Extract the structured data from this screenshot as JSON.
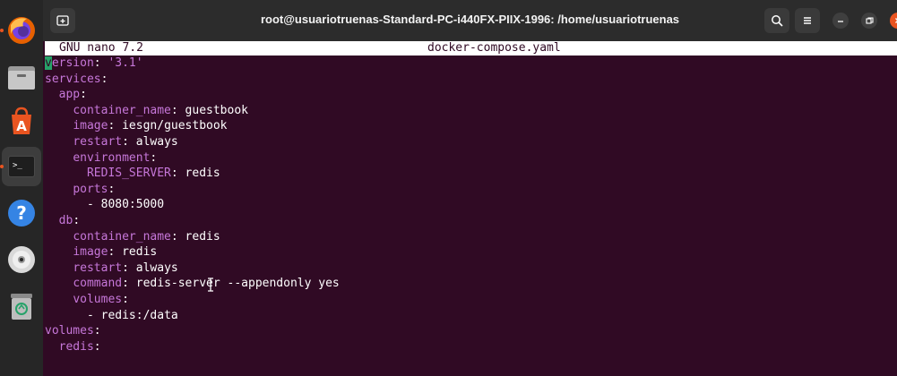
{
  "window": {
    "title": "root@usuariotruenas-Standard-PC-i440FX-PIIX-1996: /home/usuariotruenas"
  },
  "dock": {
    "items": [
      {
        "name": "firefox-icon"
      },
      {
        "name": "files-icon"
      },
      {
        "name": "app-center-icon"
      },
      {
        "name": "terminal-icon"
      },
      {
        "name": "help-icon"
      },
      {
        "name": "disc-icon"
      },
      {
        "name": "trash-icon"
      }
    ]
  },
  "nano": {
    "version": "GNU nano 7.2",
    "filename": "docker-compose.yaml"
  },
  "file_lines": [
    {
      "indent": "",
      "key": "version",
      "sep": ": ",
      "value": "'3.1'",
      "value_is_string": true
    },
    {
      "indent": "",
      "key": "services",
      "sep": ":",
      "value": ""
    },
    {
      "indent": "  ",
      "key": "app",
      "sep": ":",
      "value": ""
    },
    {
      "indent": "    ",
      "key": "container_name",
      "sep": ": ",
      "value": "guestbook"
    },
    {
      "indent": "    ",
      "key": "image",
      "sep": ": ",
      "value": "iesgn/guestbook"
    },
    {
      "indent": "    ",
      "key": "restart",
      "sep": ": ",
      "value": "always"
    },
    {
      "indent": "    ",
      "key": "environment",
      "sep": ":",
      "value": ""
    },
    {
      "indent": "      ",
      "key": "REDIS_SERVER",
      "sep": ": ",
      "value": "redis"
    },
    {
      "indent": "    ",
      "key": "ports",
      "sep": ":",
      "value": ""
    },
    {
      "indent": "      ",
      "key": "",
      "sep": "- ",
      "value": "8080:5000"
    },
    {
      "indent": "  ",
      "key": "db",
      "sep": ":",
      "value": ""
    },
    {
      "indent": "    ",
      "key": "container_name",
      "sep": ": ",
      "value": "redis"
    },
    {
      "indent": "    ",
      "key": "image",
      "sep": ": ",
      "value": "redis"
    },
    {
      "indent": "    ",
      "key": "restart",
      "sep": ": ",
      "value": "always"
    },
    {
      "indent": "    ",
      "key": "command",
      "sep": ": ",
      "value": "redis-server --appendonly yes"
    },
    {
      "indent": "    ",
      "key": "volumes",
      "sep": ":",
      "value": ""
    },
    {
      "indent": "      ",
      "key": "",
      "sep": "- ",
      "value": "redis:/data"
    },
    {
      "indent": "",
      "key": "volumes",
      "sep": ":",
      "value": ""
    },
    {
      "indent": "  ",
      "key": "redis",
      "sep": ":",
      "value": ""
    }
  ],
  "colors": {
    "terminal_bg": "#300a24",
    "yaml_key": "#c677d9",
    "cursor": "#26a269",
    "accent": "#e95420"
  }
}
